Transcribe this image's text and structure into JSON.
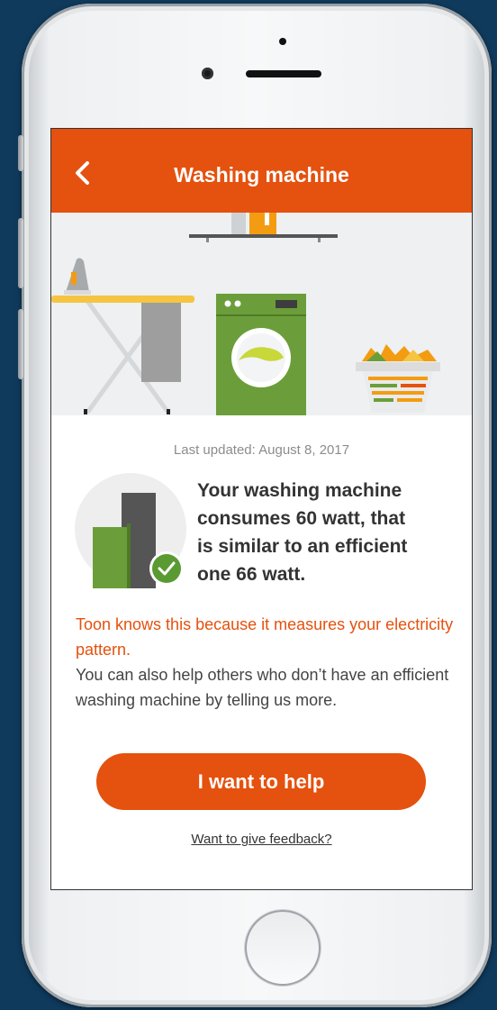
{
  "appbar": {
    "title": "Washing machine",
    "back_icon": "chevron-left-icon",
    "color": "#e5510e"
  },
  "hero": {
    "illustration": "laundry-room-illustration",
    "icons": [
      "ceiling-lamp-icon",
      "iron-icon",
      "ironing-board-icon",
      "washing-machine-icon",
      "laundry-basket-icon"
    ]
  },
  "content": {
    "last_updated": "Last updated: August 8, 2017",
    "comparison_icon": "energy-comparison-bars-icon",
    "check_icon": "check-circle-icon",
    "summary_lines": [
      "Your washing machine",
      "consumes 60 watt, that",
      "is similar to an efficient",
      "one 66 watt."
    ],
    "explanation": "Toon knows this because it measures your electricity pattern.",
    "help_text": "You can also help others who don’t have an efficient washing machine by telling us more.",
    "cta_label": "I want to help",
    "feedback_link": "Want to give feedback?"
  },
  "colors": {
    "accent": "#e5510e",
    "green": "#6b9e3a",
    "dark_bar": "#555555",
    "background": "#0f3a5c"
  }
}
